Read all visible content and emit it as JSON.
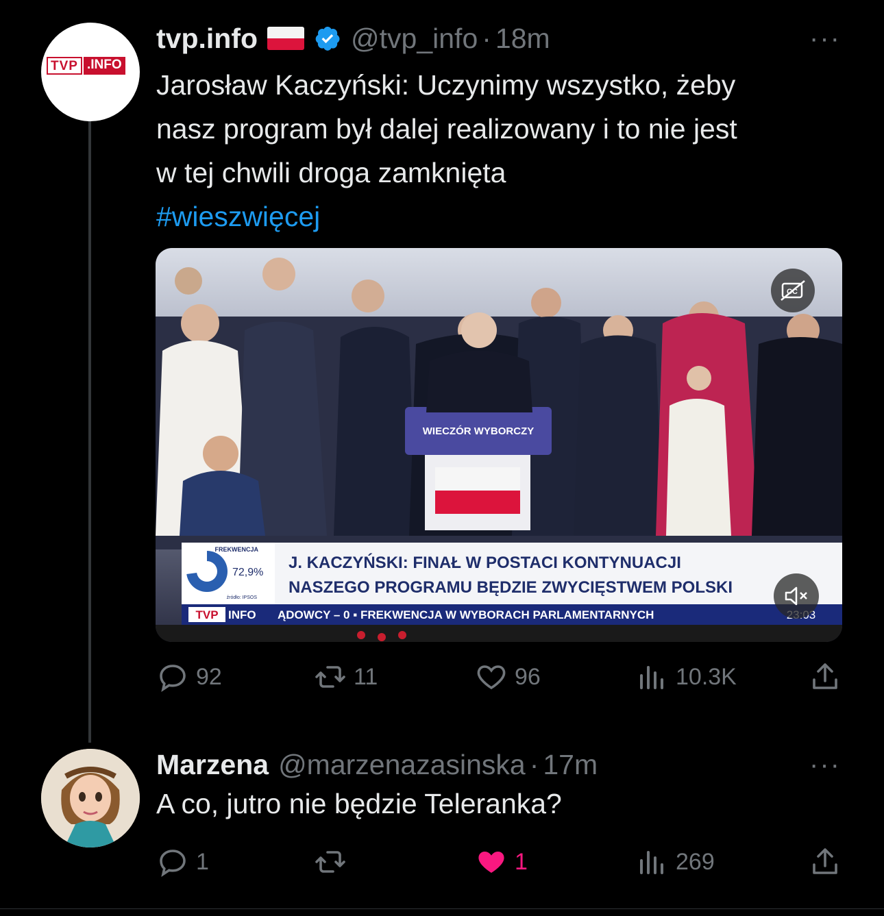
{
  "tweet1": {
    "display_name": "tvp.info",
    "handle": "@tvp_info",
    "separator": "·",
    "time": "18m",
    "more": "···",
    "avatar_logo": {
      "left": "TVP",
      "right": ".INFO"
    },
    "text_line1": "Jarosław Kaczyński: Uczynimy wszystko, żeby",
    "text_line2": "nasz program był dalej realizowany i to nie jest",
    "text_line3": "w tej chwili droga zamknięta",
    "hashtag": "#wieszwięcej",
    "media": {
      "podium_sign": "WIECZÓR WYBORCZY",
      "frekwencja_label": "FREKWENCJA",
      "frekwencja_value": "72,9%",
      "frekwencja_fraction": 0.729,
      "source_label": "źródło: IPSOS",
      "headline_line1": "J. KACZYŃSKI: FINAŁ W POSTACI KONTYNUACJI",
      "headline_line2": "NASZEGO PROGRAMU BĘDZIE ZWYCIĘSTWEM POLSKI",
      "ticker_brand_left": "TVP",
      "ticker_brand_right": "INFO",
      "ticker_text": "ĄDOWCY – 0 ▪ FREKWENCJA W WYBORACH PARLAMENTARNYCH",
      "clock": "23:03",
      "cc_icon": "closed-captions-off-icon",
      "mute_icon": "speaker-muted-icon"
    },
    "stats": {
      "replies": "92",
      "retweets": "11",
      "likes": "96",
      "views": "10.3K"
    }
  },
  "tweet2": {
    "display_name": "Marzena",
    "handle": "@marzenazasinska",
    "separator": "·",
    "time": "17m",
    "more": "···",
    "text": "A co, jutro nie będzie Teleranka?",
    "stats": {
      "replies": "1",
      "retweets": "",
      "likes": "1",
      "views": "269"
    },
    "liked": true
  },
  "colors": {
    "background": "#000000",
    "text": "#e7e9ea",
    "muted": "#71767b",
    "link": "#1d9bf0",
    "like_active": "#f91880",
    "tvp_red": "#c8102e"
  }
}
